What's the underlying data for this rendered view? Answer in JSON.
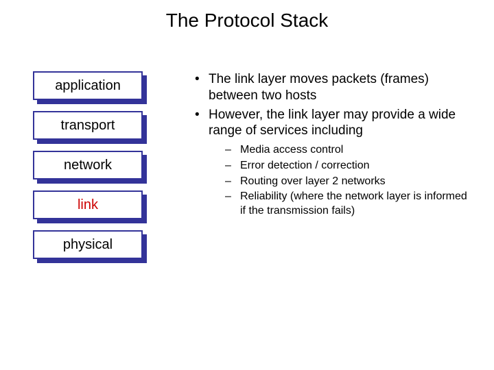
{
  "title": "The Protocol Stack",
  "stack": {
    "layers": [
      {
        "label": "application",
        "highlight": false
      },
      {
        "label": "transport",
        "highlight": false
      },
      {
        "label": "network",
        "highlight": false
      },
      {
        "label": "link",
        "highlight": true
      },
      {
        "label": "physical",
        "highlight": false
      }
    ]
  },
  "bullets": [
    "The link layer moves packets (frames) between two hosts",
    "However, the link layer may provide a wide range of services including"
  ],
  "sub_bullets": [
    "Media access control",
    "Error detection / correction",
    "Routing over layer 2 networks",
    "Reliability (where the network layer is informed if the transmission fails)"
  ]
}
